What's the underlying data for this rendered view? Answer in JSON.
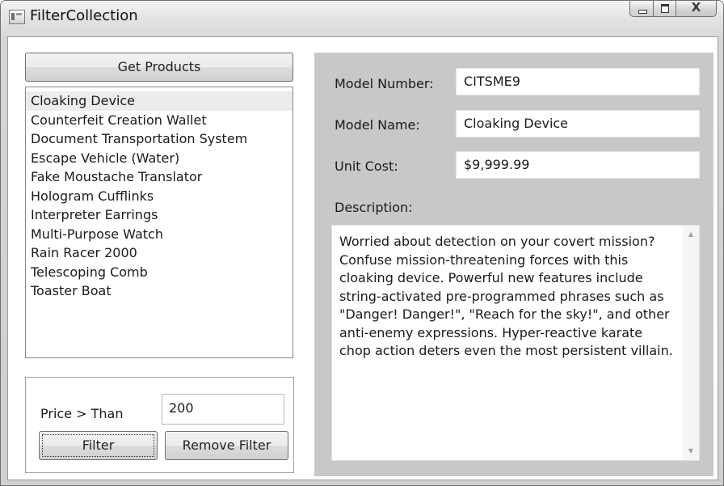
{
  "window": {
    "title": "FilterCollection",
    "caption": {
      "minimize_glyph": "",
      "maximize_glyph": "",
      "close_glyph": "X"
    }
  },
  "left": {
    "get_products_label": "Get Products",
    "products": [
      "Cloaking Device",
      "Counterfeit Creation Wallet",
      "Document Transportation System",
      "Escape Vehicle (Water)",
      "Fake Moustache Translator",
      "Hologram Cufflinks",
      "Interpreter Earrings",
      "Multi-Purpose Watch",
      "Rain Racer 2000",
      "Telescoping Comb",
      "Toaster Boat"
    ],
    "selected_index": 0,
    "filter": {
      "price_label": "Price > Than",
      "price_value": "200",
      "filter_label": "Filter",
      "remove_filter_label": "Remove Filter"
    }
  },
  "details": {
    "model_number_label": "Model Number:",
    "model_number": "CITSME9",
    "model_name_label": "Model Name:",
    "model_name": "Cloaking Device",
    "unit_cost_label": "Unit Cost:",
    "unit_cost": "$9,999.99",
    "description_label": "Description:",
    "description": "Worried about detection on your covert mission? Confuse mission-threatening forces with this cloaking device. Powerful new features include string-activated pre-programmed phrases such as \"Danger! Danger!\", \"Reach for the sky!\", and other anti-enemy expressions. Hyper-reactive karate chop action deters even the most persistent villain."
  }
}
